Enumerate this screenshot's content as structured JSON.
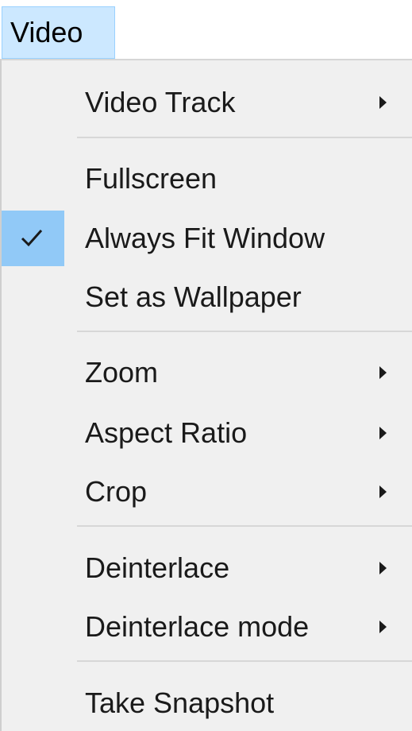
{
  "menubar": {
    "active_menu_label": "Video"
  },
  "menu": {
    "items": [
      {
        "label": "Video Track",
        "submenu": true,
        "checked": false
      },
      {
        "label": "Fullscreen",
        "submenu": false,
        "checked": false
      },
      {
        "label": "Always Fit Window",
        "submenu": false,
        "checked": true
      },
      {
        "label": "Set as Wallpaper",
        "submenu": false,
        "checked": false
      },
      {
        "label": "Zoom",
        "submenu": true,
        "checked": false
      },
      {
        "label": "Aspect Ratio",
        "submenu": true,
        "checked": false
      },
      {
        "label": "Crop",
        "submenu": true,
        "checked": false
      },
      {
        "label": "Deinterlace",
        "submenu": true,
        "checked": false
      },
      {
        "label": "Deinterlace mode",
        "submenu": true,
        "checked": false
      },
      {
        "label": "Take Snapshot",
        "submenu": false,
        "checked": false
      }
    ]
  },
  "colors": {
    "menubar_highlight": "#cce8ff",
    "check_highlight": "#91c9f7",
    "menu_background": "#f0f0f0"
  }
}
